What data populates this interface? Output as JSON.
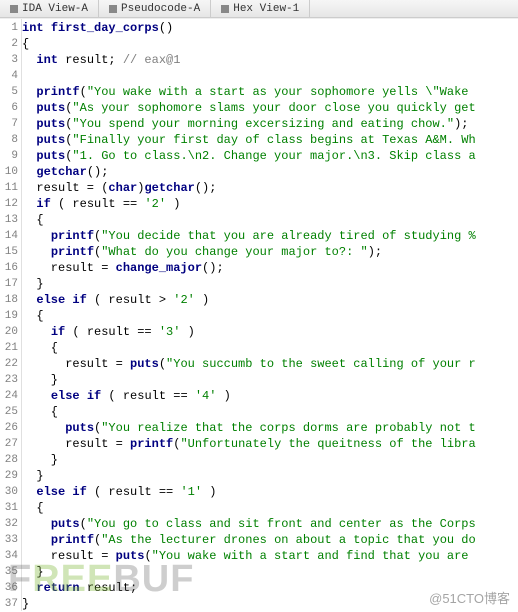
{
  "tabs": [
    {
      "label": "IDA View-A"
    },
    {
      "label": "Pseudocode-A"
    },
    {
      "label": "Hex View-1"
    }
  ],
  "watermark1": "FREEBUF",
  "watermark2": "@51CTO博客",
  "chart_data": {
    "type": "table",
    "title": "decompiled C pseudocode",
    "lines": [
      {
        "n": 1,
        "raw": "int first_day_corps()",
        "tokens": [
          [
            "kw",
            "int"
          ],
          [
            "",
            null
          ],
          [
            "fn",
            "first_day_corps"
          ],
          [
            "",
            "()"
          ]
        ]
      },
      {
        "n": 2,
        "raw": "{",
        "tokens": [
          [
            "",
            "{"
          ]
        ]
      },
      {
        "n": 3,
        "raw": "  int result; // eax@1",
        "tokens": [
          [
            "",
            "  "
          ],
          [
            "kw",
            "int"
          ],
          [
            "",
            " result; "
          ],
          [
            "cmt",
            "// eax@1"
          ]
        ]
      },
      {
        "n": 4,
        "raw": "",
        "tokens": []
      },
      {
        "n": 5,
        "raw": "  printf(\"You wake with a start as your sophomore yells \\\"Wake ",
        "tokens": [
          [
            "",
            "  "
          ],
          [
            "fn",
            "printf"
          ],
          [
            "",
            "("
          ],
          [
            "str",
            "\"You wake with a start as your sophomore yells \\\"Wake "
          ]
        ]
      },
      {
        "n": 6,
        "raw": "  puts(\"As your sophomore slams your door close you quickly get",
        "tokens": [
          [
            "",
            "  "
          ],
          [
            "fn",
            "puts"
          ],
          [
            "",
            "("
          ],
          [
            "str",
            "\"As your sophomore slams your door close you quickly get"
          ]
        ]
      },
      {
        "n": 7,
        "raw": "  puts(\"You spend your morning excersizing and eating chow.\");",
        "tokens": [
          [
            "",
            "  "
          ],
          [
            "fn",
            "puts"
          ],
          [
            "",
            "("
          ],
          [
            "str",
            "\"You spend your morning excersizing and eating chow.\""
          ],
          [
            "",
            ");"
          ]
        ]
      },
      {
        "n": 8,
        "raw": "  puts(\"Finally your first day of class begins at Texas A&M. Wh",
        "tokens": [
          [
            "",
            "  "
          ],
          [
            "fn",
            "puts"
          ],
          [
            "",
            "("
          ],
          [
            "str",
            "\"Finally your first day of class begins at Texas A&M. Wh"
          ]
        ]
      },
      {
        "n": 9,
        "raw": "  puts(\"1. Go to class.\\n2. Change your major.\\n3. Skip class a",
        "tokens": [
          [
            "",
            "  "
          ],
          [
            "fn",
            "puts"
          ],
          [
            "",
            "("
          ],
          [
            "str",
            "\"1. Go to class.\\n2. Change your major.\\n3. Skip class a"
          ]
        ]
      },
      {
        "n": 10,
        "raw": "  getchar();",
        "tokens": [
          [
            "",
            "  "
          ],
          [
            "fn",
            "getchar"
          ],
          [
            "",
            "();"
          ]
        ]
      },
      {
        "n": 11,
        "raw": "  result = (char)getchar();",
        "tokens": [
          [
            "",
            "  result = ("
          ],
          [
            "kw",
            "char"
          ],
          [
            "",
            ")"
          ],
          [
            "fn",
            "getchar"
          ],
          [
            "",
            "();"
          ]
        ]
      },
      {
        "n": 12,
        "raw": "  if ( result == '2' )",
        "tokens": [
          [
            "",
            "  "
          ],
          [
            "kw",
            "if"
          ],
          [
            "",
            " ( result == "
          ],
          [
            "num",
            "'2'"
          ],
          [
            "",
            " )"
          ]
        ]
      },
      {
        "n": 13,
        "raw": "  {",
        "tokens": [
          [
            "",
            "  {"
          ]
        ]
      },
      {
        "n": 14,
        "raw": "    printf(\"You decide that you are already tired of studying %",
        "tokens": [
          [
            "",
            "    "
          ],
          [
            "fn",
            "printf"
          ],
          [
            "",
            "("
          ],
          [
            "str",
            "\"You decide that you are already tired of studying %"
          ]
        ]
      },
      {
        "n": 15,
        "raw": "    printf(\"What do you change your major to?: \");",
        "tokens": [
          [
            "",
            "    "
          ],
          [
            "fn",
            "printf"
          ],
          [
            "",
            "("
          ],
          [
            "str",
            "\"What do you change your major to?: \""
          ],
          [
            "",
            ");"
          ]
        ]
      },
      {
        "n": 16,
        "raw": "    result = change_major();",
        "tokens": [
          [
            "",
            "    result = "
          ],
          [
            "fn",
            "change_major"
          ],
          [
            "",
            "();"
          ]
        ]
      },
      {
        "n": 17,
        "raw": "  }",
        "tokens": [
          [
            "",
            "  }"
          ]
        ]
      },
      {
        "n": 18,
        "raw": "  else if ( result > '2' )",
        "tokens": [
          [
            "",
            "  "
          ],
          [
            "kw",
            "else if"
          ],
          [
            "",
            " ( result > "
          ],
          [
            "num",
            "'2'"
          ],
          [
            "",
            " )"
          ]
        ]
      },
      {
        "n": 19,
        "raw": "  {",
        "tokens": [
          [
            "",
            "  {"
          ]
        ]
      },
      {
        "n": 20,
        "raw": "    if ( result == '3' )",
        "tokens": [
          [
            "",
            "    "
          ],
          [
            "kw",
            "if"
          ],
          [
            "",
            " ( result == "
          ],
          [
            "num",
            "'3'"
          ],
          [
            "",
            " )"
          ]
        ]
      },
      {
        "n": 21,
        "raw": "    {",
        "tokens": [
          [
            "",
            "    {"
          ]
        ]
      },
      {
        "n": 22,
        "raw": "      result = puts(\"You succumb to the sweet calling of your r",
        "tokens": [
          [
            "",
            "      result = "
          ],
          [
            "fn",
            "puts"
          ],
          [
            "",
            "("
          ],
          [
            "str",
            "\"You succumb to the sweet calling of your r"
          ]
        ]
      },
      {
        "n": 23,
        "raw": "    }",
        "tokens": [
          [
            "",
            "    }"
          ]
        ]
      },
      {
        "n": 24,
        "raw": "    else if ( result == '4' )",
        "tokens": [
          [
            "",
            "    "
          ],
          [
            "kw",
            "else if"
          ],
          [
            "",
            " ( result == "
          ],
          [
            "num",
            "'4'"
          ],
          [
            "",
            " )"
          ]
        ]
      },
      {
        "n": 25,
        "raw": "    {",
        "tokens": [
          [
            "",
            "    {"
          ]
        ]
      },
      {
        "n": 26,
        "raw": "      puts(\"You realize that the corps dorms are probably not t",
        "tokens": [
          [
            "",
            "      "
          ],
          [
            "fn",
            "puts"
          ],
          [
            "",
            "("
          ],
          [
            "str",
            "\"You realize that the corps dorms are probably not t"
          ]
        ]
      },
      {
        "n": 27,
        "raw": "      result = printf(\"Unfortunately the queitness of the libra",
        "tokens": [
          [
            "",
            "      result = "
          ],
          [
            "fn",
            "printf"
          ],
          [
            "",
            "("
          ],
          [
            "str",
            "\"Unfortunately the queitness of the libra"
          ]
        ]
      },
      {
        "n": 28,
        "raw": "    }",
        "tokens": [
          [
            "",
            "    }"
          ]
        ]
      },
      {
        "n": 29,
        "raw": "  }",
        "tokens": [
          [
            "",
            "  }"
          ]
        ]
      },
      {
        "n": 30,
        "raw": "  else if ( result == '1' )",
        "tokens": [
          [
            "",
            "  "
          ],
          [
            "kw",
            "else if"
          ],
          [
            "",
            " ( result == "
          ],
          [
            "num",
            "'1'"
          ],
          [
            "",
            " )"
          ]
        ]
      },
      {
        "n": 31,
        "raw": "  {",
        "tokens": [
          [
            "",
            "  {"
          ]
        ]
      },
      {
        "n": 32,
        "raw": "    puts(\"You go to class and sit front and center as the Corps",
        "tokens": [
          [
            "",
            "    "
          ],
          [
            "fn",
            "puts"
          ],
          [
            "",
            "("
          ],
          [
            "str",
            "\"You go to class and sit front and center as the Corps"
          ]
        ]
      },
      {
        "n": 33,
        "raw": "    printf(\"As the lecturer drones on about a topic that you do",
        "tokens": [
          [
            "",
            "    "
          ],
          [
            "fn",
            "printf"
          ],
          [
            "",
            "("
          ],
          [
            "str",
            "\"As the lecturer drones on about a topic that you do"
          ]
        ]
      },
      {
        "n": 34,
        "raw": "    result = puts(\"You wake with a start and find that you are ",
        "tokens": [
          [
            "",
            "    result = "
          ],
          [
            "fn",
            "puts"
          ],
          [
            "",
            "("
          ],
          [
            "str",
            "\"You wake with a start and find that you are "
          ]
        ]
      },
      {
        "n": 35,
        "raw": "  }",
        "tokens": [
          [
            "",
            "  }"
          ]
        ]
      },
      {
        "n": 36,
        "raw": "  return result;",
        "tokens": [
          [
            "",
            "  "
          ],
          [
            "kw",
            "return"
          ],
          [
            "",
            " result;"
          ]
        ]
      },
      {
        "n": 37,
        "raw": "}",
        "tokens": [
          [
            "",
            "}"
          ]
        ]
      }
    ]
  }
}
